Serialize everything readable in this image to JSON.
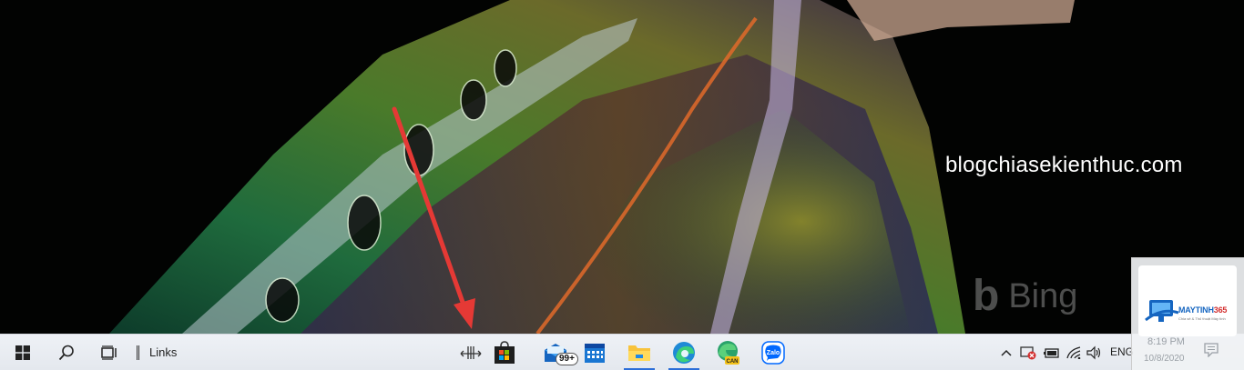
{
  "desktop": {
    "watermark_site": "blogchiasekienthuc.com",
    "bing_logo": "b",
    "bing_text": "Bing"
  },
  "taskbar": {
    "start_icon": "windows-logo-icon",
    "search_icon": "search-icon",
    "task_view_icon": "task-view-icon",
    "links_label": "Links",
    "toolbar_grip_icon": "toolbar-grip-icon",
    "apps": [
      {
        "name": "microsoft-store",
        "icon": "store-bag-icon"
      },
      {
        "name": "mail",
        "icon": "mail-icon",
        "badge": "99+"
      },
      {
        "name": "calendar",
        "icon": "calendar-icon"
      },
      {
        "name": "file-explorer",
        "icon": "folder-icon",
        "active": true
      },
      {
        "name": "edge",
        "icon": "edge-icon",
        "active": true
      },
      {
        "name": "edge-canary",
        "icon": "edge-canary-icon",
        "label": "CAN"
      },
      {
        "name": "zalo",
        "icon": "zalo-icon",
        "label": "Zalo"
      }
    ],
    "tray": {
      "chevron_icon": "chevron-up-icon",
      "antivirus_icon": "defender-alert-icon",
      "battery_icon": "battery-icon",
      "wifi_icon": "wifi-icon",
      "volume_icon": "volume-icon",
      "language": "ENG",
      "time": "8:19 PM",
      "date": "10/8/2020",
      "notifications_icon": "action-center-icon"
    }
  },
  "overlay_logo": {
    "brand_main": "MAYTINH",
    "brand_num": "365",
    "tagline": "Chia sẻ & Thủ thuật Máy tính"
  },
  "colors": {
    "taskbar_bg": "#e9ecf1",
    "active_indicator": "#2b6ed8",
    "arrow_red": "#e53935"
  }
}
